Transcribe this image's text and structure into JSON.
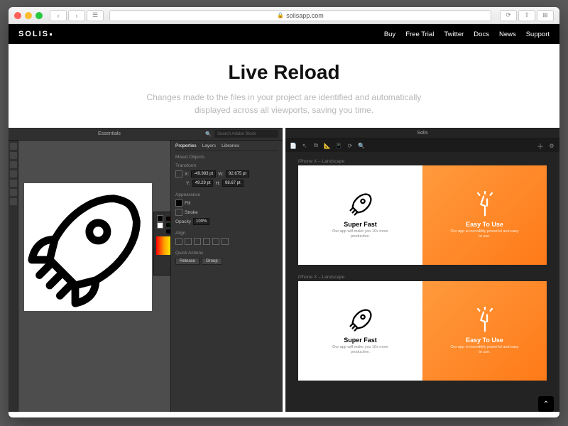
{
  "browser": {
    "url_host": "solisapp.com"
  },
  "nav": {
    "brand": "SOLIS",
    "links": [
      "Buy",
      "Free Trial",
      "Twitter",
      "Docs",
      "News",
      "Support"
    ]
  },
  "hero": {
    "title": "Live Reload",
    "subtitle": "Changes made to the files in your project are identified and automatically displayed across all viewports, saving you time."
  },
  "illustrator": {
    "workspace_label": "Essentials",
    "search_placeholder": "Search Adobe Stock",
    "panel_tabs": [
      "Properties",
      "Layers",
      "Libraries"
    ],
    "section_mixed": "Mixed Objects",
    "section_transform": "Transform",
    "x_value": "-49.983 pt",
    "y_value": "49.29 pt",
    "w_value": "92.675 pt",
    "h_value": "98.67 pt",
    "section_appearance": "Appearance",
    "fill_label": "Fill",
    "stroke_label": "Stroke",
    "opacity_label": "Opacity",
    "opacity_value": "100%",
    "section_align": "Align",
    "section_quick": "Quick Actions",
    "btn_release": "Release",
    "btn_group": "Group",
    "picker_hex": "fc7040"
  },
  "solis": {
    "app_title": "Solis",
    "viewport_label": "iPhone X – Landscape",
    "card_left_title": "Super Fast",
    "card_left_sub": "Our app will make you 10x more productive.",
    "card_right_title": "Easy To Use",
    "card_right_sub": "Our app is incredibly powerful and easy to use."
  }
}
